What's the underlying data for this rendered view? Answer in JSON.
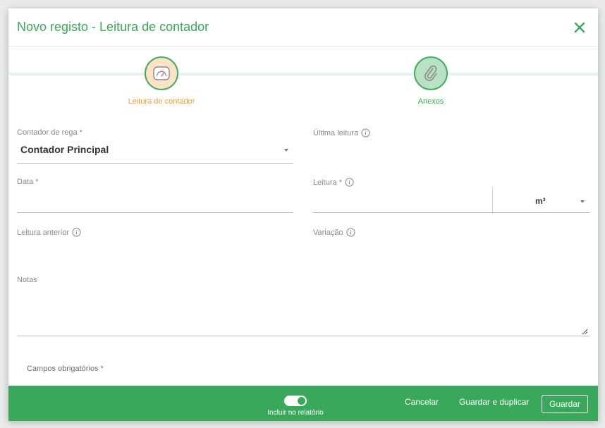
{
  "modal": {
    "title": "Novo registo - Leitura de contador"
  },
  "stepper": {
    "steps": [
      {
        "label": "Leitura de contador",
        "icon": "gauge-icon",
        "active": true
      },
      {
        "label": "Anexos",
        "icon": "paperclip-icon",
        "active": false
      }
    ]
  },
  "form": {
    "contador": {
      "label": "Contador de rega *",
      "value": "Contador Principal"
    },
    "ultima_leitura": {
      "label": "Última leitura"
    },
    "data": {
      "label": "Data *",
      "value": ""
    },
    "leitura": {
      "label": "Leitura *",
      "value": "",
      "unit": "m³"
    },
    "leitura_anterior": {
      "label": "Leitura anterior"
    },
    "variacao": {
      "label": "Variação"
    },
    "notas": {
      "label": "Notas",
      "value": ""
    },
    "required_note": "Campos obrigatórios *"
  },
  "footer": {
    "toggle_label": "Incluir no relatório",
    "toggle_on": true,
    "cancel_label": "Cancelar",
    "save_duplicate_label": "Guardar e duplicar",
    "save_label": "Guardar"
  },
  "colors": {
    "accent_green": "#3aa85b",
    "accent_orange": "#f39a31"
  }
}
